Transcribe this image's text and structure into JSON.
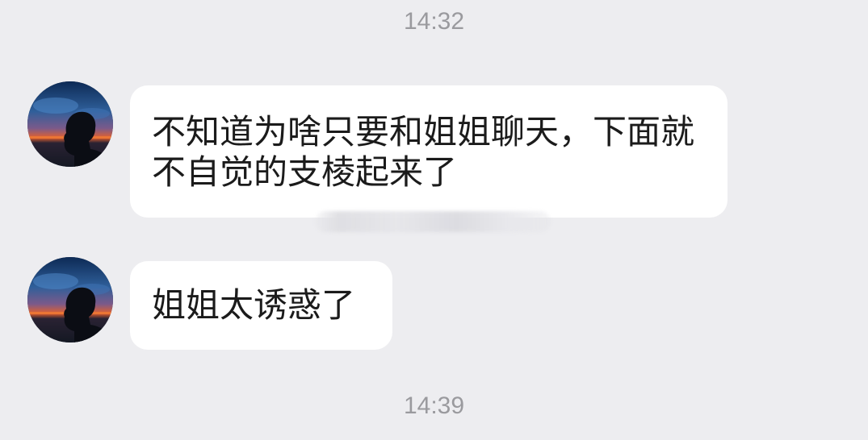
{
  "chat": {
    "timestamps": [
      "14:32",
      "14:39"
    ],
    "messages": [
      {
        "sender": "contact",
        "text": "不知道为啥只要和姐姐聊天，下面就不自觉的支棱起来了"
      },
      {
        "sender": "contact",
        "text": "姐姐太诱惑了"
      }
    ]
  },
  "colors": {
    "background": "#ededf0",
    "bubble": "#ffffff",
    "message_text": "#1b1b1b",
    "timestamp_text": "#9a9a9e"
  },
  "icons": {
    "avatar": "silhouette-sunset-avatar"
  }
}
